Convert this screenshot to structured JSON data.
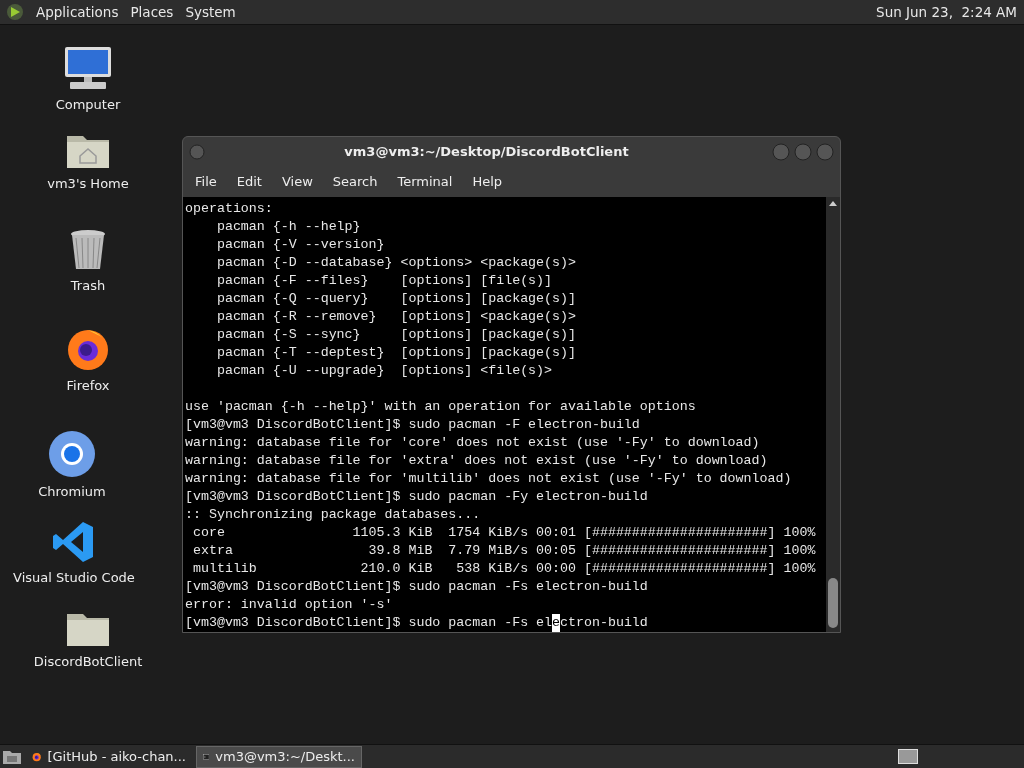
{
  "top_panel": {
    "menus": [
      "Applications",
      "Places",
      "System"
    ],
    "clock": "Sun Jun 23,  2:24 AM"
  },
  "desktop_icons": [
    {
      "kind": "computer",
      "label": "Computer"
    },
    {
      "kind": "home",
      "label": "vm3's Home"
    },
    {
      "kind": "trash",
      "label": "Trash"
    },
    {
      "kind": "firefox",
      "label": "Firefox"
    },
    {
      "kind": "chromium",
      "label": "Chromium"
    },
    {
      "kind": "vscode",
      "label": "Visual Studio Code"
    },
    {
      "kind": "folder",
      "label": "DiscordBotClient"
    }
  ],
  "terminal": {
    "title": "vm3@vm3:~/Desktop/DiscordBotClient",
    "menu": [
      "File",
      "Edit",
      "View",
      "Search",
      "Terminal",
      "Help"
    ],
    "output_blocks": [
      [
        "operations:",
        "    pacman {-h --help}",
        "    pacman {-V --version}",
        "    pacman {-D --database} <options> <package(s)>",
        "    pacman {-F --files}    [options] [file(s)]",
        "    pacman {-Q --query}    [options] [package(s)]",
        "    pacman {-R --remove}   [options] <package(s)>",
        "    pacman {-S --sync}     [options] [package(s)]",
        "    pacman {-T --deptest}  [options] [package(s)]",
        "    pacman {-U --upgrade}  [options] <file(s)>"
      ],
      [
        "use 'pacman {-h --help}' with an operation for available options",
        "[vm3@vm3 DiscordBotClient]$ sudo pacman -F electron-build",
        "warning: database file for 'core' does not exist (use '-Fy' to download)",
        "warning: database file for 'extra' does not exist (use '-Fy' to download)",
        "warning: database file for 'multilib' does not exist (use '-Fy' to download)",
        "[vm3@vm3 DiscordBotClient]$ sudo pacman -Fy electron-build",
        ":: Synchronizing package databases...",
        " core                1105.3 KiB  1754 KiB/s 00:01 [######################] 100%",
        " extra                 39.8 MiB  7.79 MiB/s 00:05 [######################] 100%",
        " multilib             210.0 KiB   538 KiB/s 00:00 [######################] 100%",
        "[vm3@vm3 DiscordBotClient]$ sudo pacman -Fs electron-build",
        "error: invalid option '-s'"
      ]
    ],
    "prompt": {
      "before": "[vm3@vm3 DiscordBotClient]$ sudo pacman -Fs el",
      "cursor": "e",
      "after": "ctron-build"
    }
  },
  "taskbar": [
    {
      "kind": "firefox",
      "label": "[GitHub - aiko-chan...",
      "selected": false
    },
    {
      "kind": "terminal",
      "label": "vm3@vm3:~/Deskt...",
      "selected": true
    }
  ]
}
